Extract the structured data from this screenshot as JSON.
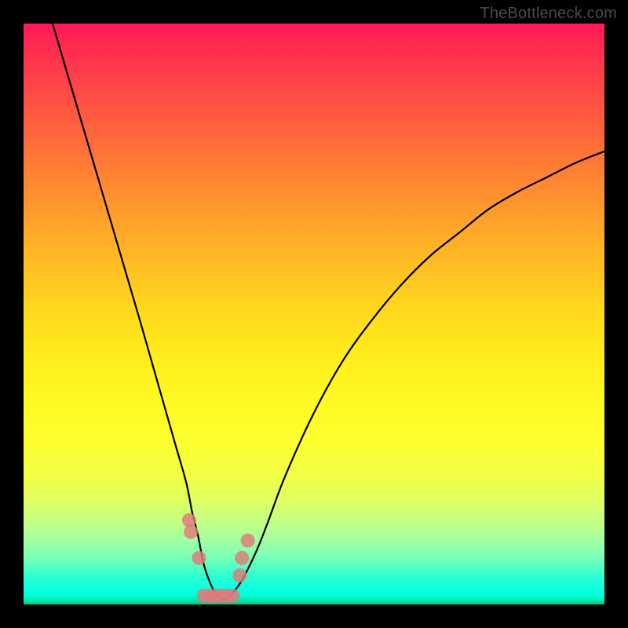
{
  "watermark": "TheBottleneck.com",
  "chart_data": {
    "type": "line",
    "title": "",
    "xlabel": "",
    "ylabel": "",
    "xlim": [
      0,
      100
    ],
    "ylim": [
      0,
      100
    ],
    "x": [
      5,
      10,
      15,
      20,
      22,
      24,
      26,
      28,
      29,
      30,
      31,
      32,
      33,
      34,
      35,
      36,
      37.5,
      40,
      42,
      45,
      50,
      55,
      60,
      65,
      70,
      75,
      80,
      85,
      90,
      95,
      100
    ],
    "values": [
      100,
      83,
      66,
      49,
      42,
      35,
      28,
      21,
      16,
      12,
      7,
      4,
      2,
      1,
      1,
      2,
      4,
      9,
      14,
      22,
      33,
      42,
      49,
      55,
      60,
      64,
      68,
      71,
      73.5,
      76,
      78
    ],
    "markers": {
      "x": [
        28.5,
        28.8,
        30.2,
        31,
        32,
        33,
        34,
        35,
        36,
        37.2,
        37.6,
        38.6
      ],
      "y": [
        14.5,
        12.5,
        8,
        1.5,
        1.5,
        1.5,
        1.5,
        1.5,
        1.5,
        5,
        8,
        11
      ]
    },
    "background_gradient": {
      "top": "#ff1a55",
      "middle": "#ffe820",
      "bottom": "#00c878"
    },
    "curve_color": "#000000",
    "marker_color": "#e07a7a"
  }
}
